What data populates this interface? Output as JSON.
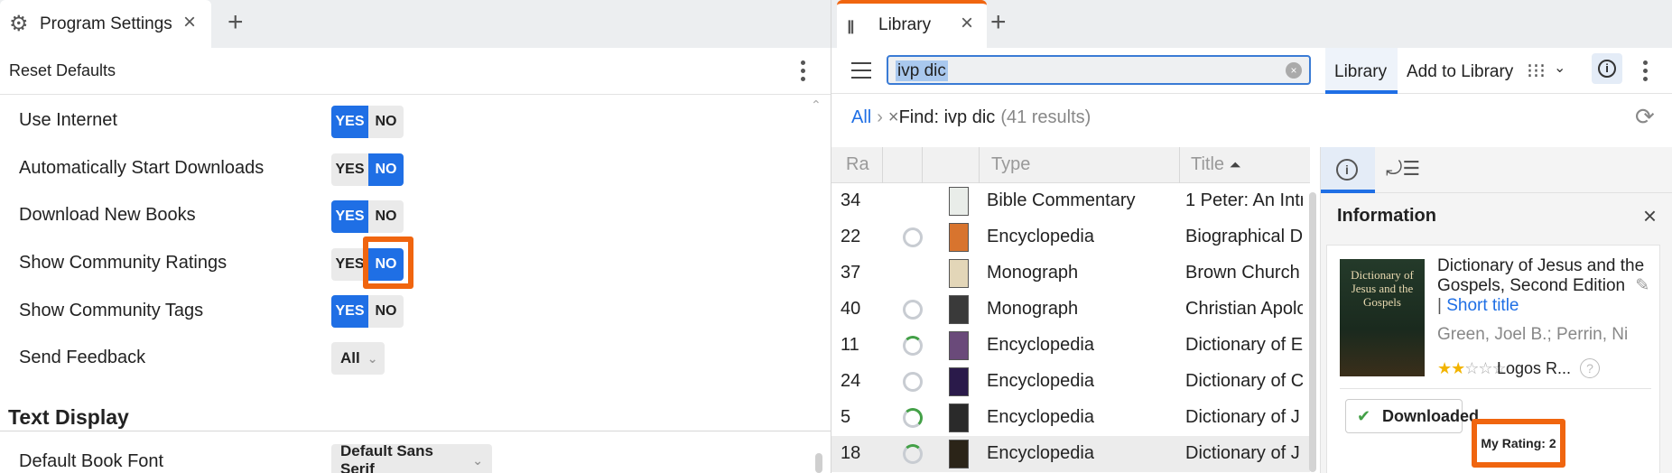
{
  "left": {
    "tab": {
      "label": "Program Settings",
      "icon": "gear-icon"
    },
    "toolbar": {
      "reset_label": "Reset Defaults"
    },
    "settings": [
      {
        "label": "Use Internet",
        "yes": "YES",
        "no": "NO",
        "value": "YES"
      },
      {
        "label": "Automatically Start Downloads",
        "yes": "YES",
        "no": "NO",
        "value": "NO"
      },
      {
        "label": "Download New Books",
        "yes": "YES",
        "no": "NO",
        "value": "YES"
      },
      {
        "label": "Show Community Ratings",
        "yes": "YES",
        "no": "NO",
        "value": "NO"
      },
      {
        "label": "Show Community Tags",
        "yes": "YES",
        "no": "NO",
        "value": "YES"
      }
    ],
    "feedback": {
      "label": "Send Feedback",
      "value": "All"
    },
    "section_text_display": "Text Display",
    "font": {
      "label": "Default Book Font",
      "value": "Default Sans Serif"
    }
  },
  "right": {
    "tab": {
      "label": "Library",
      "icon": "library-icon"
    },
    "search": {
      "query": "ivp dic"
    },
    "toolbar": {
      "library_label": "Library",
      "add_label": "Add to Library"
    },
    "breadcrumb": {
      "all": "All",
      "find": "Find: ivp dic",
      "count": "(41 results)"
    },
    "columns": {
      "rating": "Ra",
      "type": "Type",
      "title": "Title"
    },
    "rows": [
      {
        "rating": "34",
        "type": "Bible Commentary",
        "title": "1 Peter: An Intr",
        "progress": "none"
      },
      {
        "rating": "22",
        "type": "Encyclopedia",
        "title": "Biographical D",
        "progress": "empty"
      },
      {
        "rating": "37",
        "type": "Monograph",
        "title": "Brown Church",
        "progress": "none"
      },
      {
        "rating": "40",
        "type": "Monograph",
        "title": "Christian Apolo",
        "progress": "empty"
      },
      {
        "rating": "11",
        "type": "Encyclopedia",
        "title": "Dictionary of E",
        "progress": "low"
      },
      {
        "rating": "24",
        "type": "Encyclopedia",
        "title": "Dictionary of C",
        "progress": "empty"
      },
      {
        "rating": "5",
        "type": "Encyclopedia",
        "title": "Dictionary of J",
        "progress": "mid"
      },
      {
        "rating": "18",
        "type": "Encyclopedia",
        "title": "Dictionary of J",
        "progress": "low"
      }
    ],
    "cover_colors": [
      "#e9ede9",
      "#d8742e",
      "#e3d6b8",
      "#3a3a3a",
      "#6a4a7a",
      "#2a1a4a",
      "#2a2a2a",
      "#2b2418"
    ],
    "info": {
      "header": "Information",
      "book_title": "Dictionary of Jesus and the Gospels, Second Edition",
      "short_title": "Short title",
      "cover_title": "Dictionary of Jesus and the Gospels",
      "author": "Green, Joel B.; Perrin, Ni",
      "rating_stars": 2,
      "rating_max": 5,
      "publisher": "Logos R...",
      "download_label": "Downloaded",
      "tooltip": "My Rating: 2"
    }
  }
}
